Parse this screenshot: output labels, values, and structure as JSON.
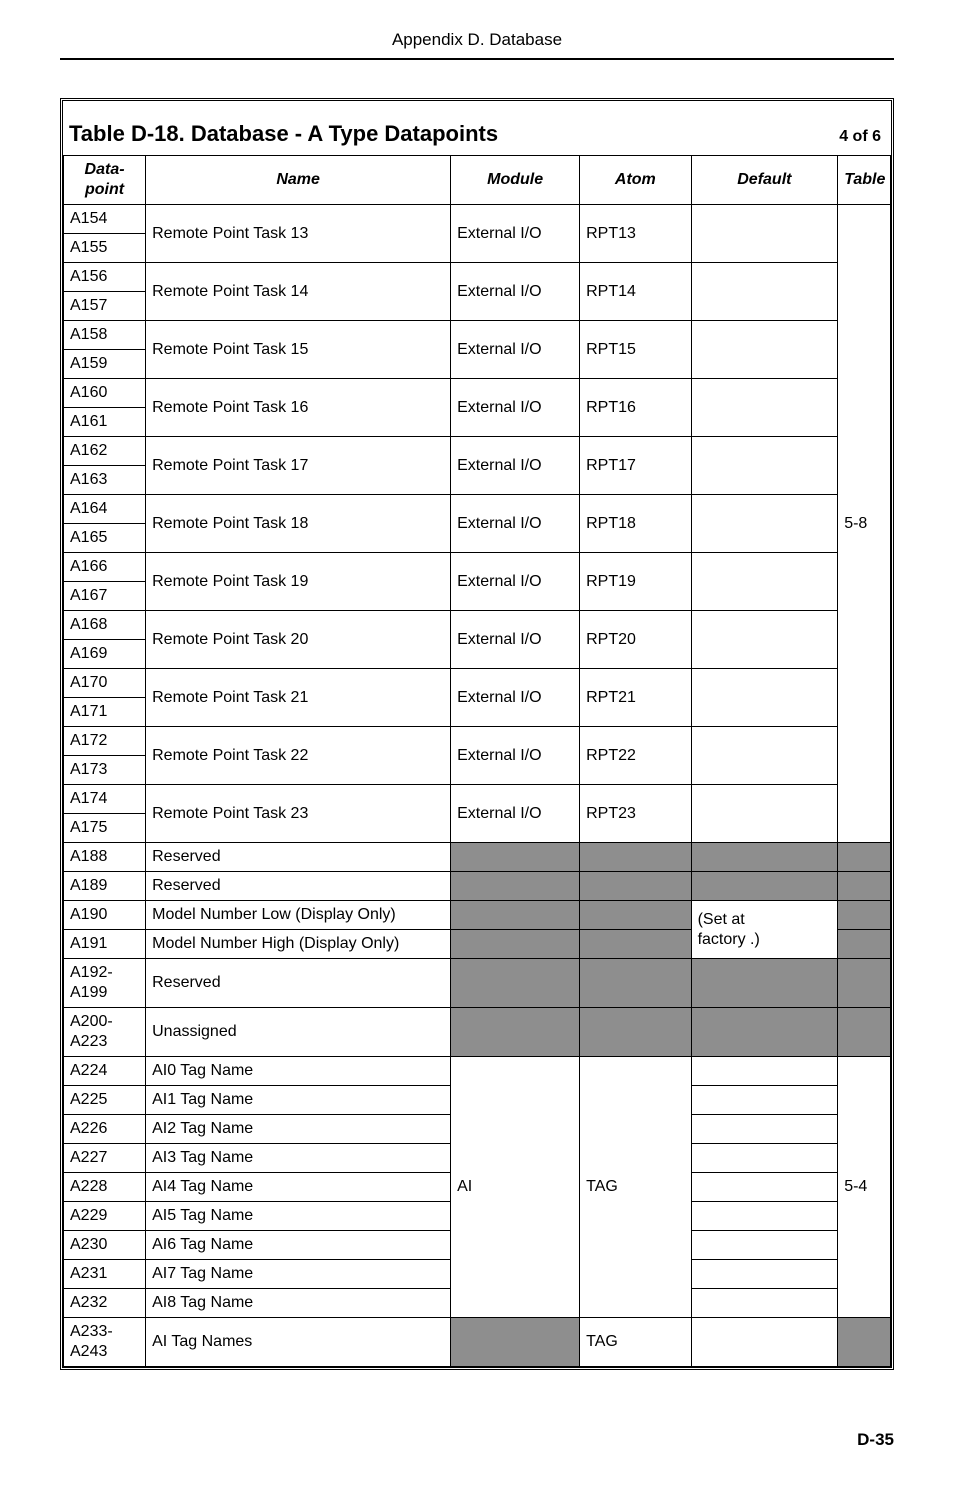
{
  "header": "Appendix D.  Database",
  "title": "Table D-18.  Database - A Type Datapoints",
  "page_of": "4 of 6",
  "footer": "D-35",
  "columns": {
    "dp": "Data-point",
    "name": "Name",
    "module": "Module",
    "atom": "Atom",
    "default": "Default",
    "table": "Table"
  },
  "group1": {
    "table": "5-8",
    "rows": [
      {
        "dp1": "A154",
        "dp2": "A155",
        "name": "Remote Point Task 13",
        "module": "External I/O",
        "atom": "RPT13"
      },
      {
        "dp1": "A156",
        "dp2": "A157",
        "name": "Remote Point Task 14",
        "module": "External I/O",
        "atom": "RPT14"
      },
      {
        "dp1": "A158",
        "dp2": "A159",
        "name": "Remote Point Task 15",
        "module": "External I/O",
        "atom": "RPT15"
      },
      {
        "dp1": "A160",
        "dp2": "A161",
        "name": "Remote Point Task 16",
        "module": "External I/O",
        "atom": "RPT16"
      },
      {
        "dp1": "A162",
        "dp2": "A163",
        "name": "Remote Point Task 17",
        "module": "External I/O",
        "atom": "RPT17"
      },
      {
        "dp1": "A164",
        "dp2": "A165",
        "name": "Remote Point Task 18",
        "module": "External I/O",
        "atom": "RPT18"
      },
      {
        "dp1": "A166",
        "dp2": "A167",
        "name": "Remote Point Task 19",
        "module": "External I/O",
        "atom": "RPT19"
      },
      {
        "dp1": "A168",
        "dp2": "A169",
        "name": "Remote Point Task 20",
        "module": "External I/O",
        "atom": "RPT20"
      },
      {
        "dp1": "A170",
        "dp2": "A171",
        "name": "Remote Point Task 21",
        "module": "External I/O",
        "atom": "RPT21"
      },
      {
        "dp1": "A172",
        "dp2": "A173",
        "name": "Remote Point Task 22",
        "module": "External I/O",
        "atom": "RPT22"
      },
      {
        "dp1": "A174",
        "dp2": "A175",
        "name": "Remote Point Task 23",
        "module": "External I/O",
        "atom": "RPT23"
      }
    ]
  },
  "middle_rows": [
    {
      "dp": "A188",
      "name": "Reserved"
    },
    {
      "dp": "A189",
      "name": "Reserved"
    },
    {
      "dp": "A190",
      "name": "Model Number Low (Display Only)",
      "default": "(Set at"
    },
    {
      "dp": "A191",
      "name": "Model Number High (Display Only)",
      "default": "factory .)"
    },
    {
      "dp": "A192-A199",
      "name": "Reserved"
    },
    {
      "dp": "A200-A223",
      "name": "Unassigned"
    }
  ],
  "group3": {
    "module": "AI",
    "atom": "TAG",
    "table": "5-4",
    "rows": [
      {
        "dp": "A224",
        "name": "AI0 Tag Name"
      },
      {
        "dp": "A225",
        "name": "AI1 Tag Name"
      },
      {
        "dp": "A226",
        "name": "AI2 Tag Name"
      },
      {
        "dp": "A227",
        "name": "AI3 Tag Name"
      },
      {
        "dp": "A228",
        "name": "AI4 Tag Name"
      },
      {
        "dp": "A229",
        "name": "AI5 Tag Name"
      },
      {
        "dp": "A230",
        "name": "AI6 Tag Name"
      },
      {
        "dp": "A231",
        "name": "AI7 Tag Name"
      },
      {
        "dp": "A232",
        "name": "AI8 Tag Name"
      }
    ]
  },
  "last_row": {
    "dp": "A233-A243",
    "name": "AI Tag Names",
    "atom": "TAG"
  }
}
